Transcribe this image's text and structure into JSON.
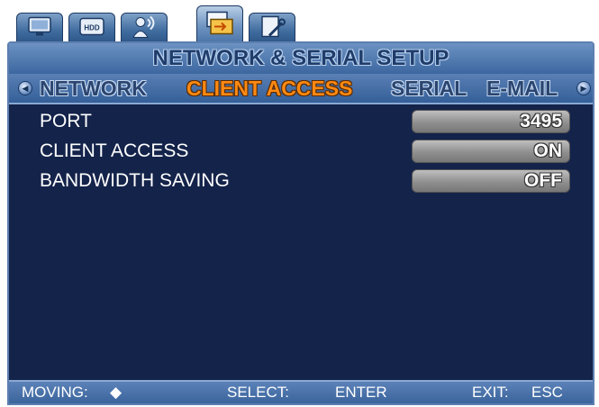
{
  "tabs": [
    {
      "icon": "monitor-icon",
      "active": false
    },
    {
      "icon": "hdd-icon",
      "label": "HDD",
      "active": false
    },
    {
      "icon": "user-wireless-icon",
      "active": false
    },
    {
      "icon": "network-folder-icon",
      "active": true
    },
    {
      "icon": "settings-tools-icon",
      "active": false
    }
  ],
  "title": "NETWORK & SERIAL SETUP",
  "subtabs": {
    "network": "NETWORK",
    "client_access": "CLIENT ACCESS",
    "serial": "SERIAL",
    "email": "E-MAIL",
    "active": "client_access"
  },
  "rows": [
    {
      "label": "PORT",
      "value": "3495"
    },
    {
      "label": "CLIENT ACCESS",
      "value": "ON"
    },
    {
      "label": "BANDWIDTH SAVING",
      "value": "OFF"
    }
  ],
  "footer": {
    "moving_label": "MOVING:",
    "moving_icon": "left-right-arrow-icon",
    "moving_glyph": "◆",
    "select_label": "SELECT:",
    "select_value": "ENTER",
    "exit_label": "EXIT:",
    "exit_value": "ESC"
  },
  "colors": {
    "background": "#14234a",
    "accent": "#ff8a12",
    "bar": "#3c679f"
  }
}
